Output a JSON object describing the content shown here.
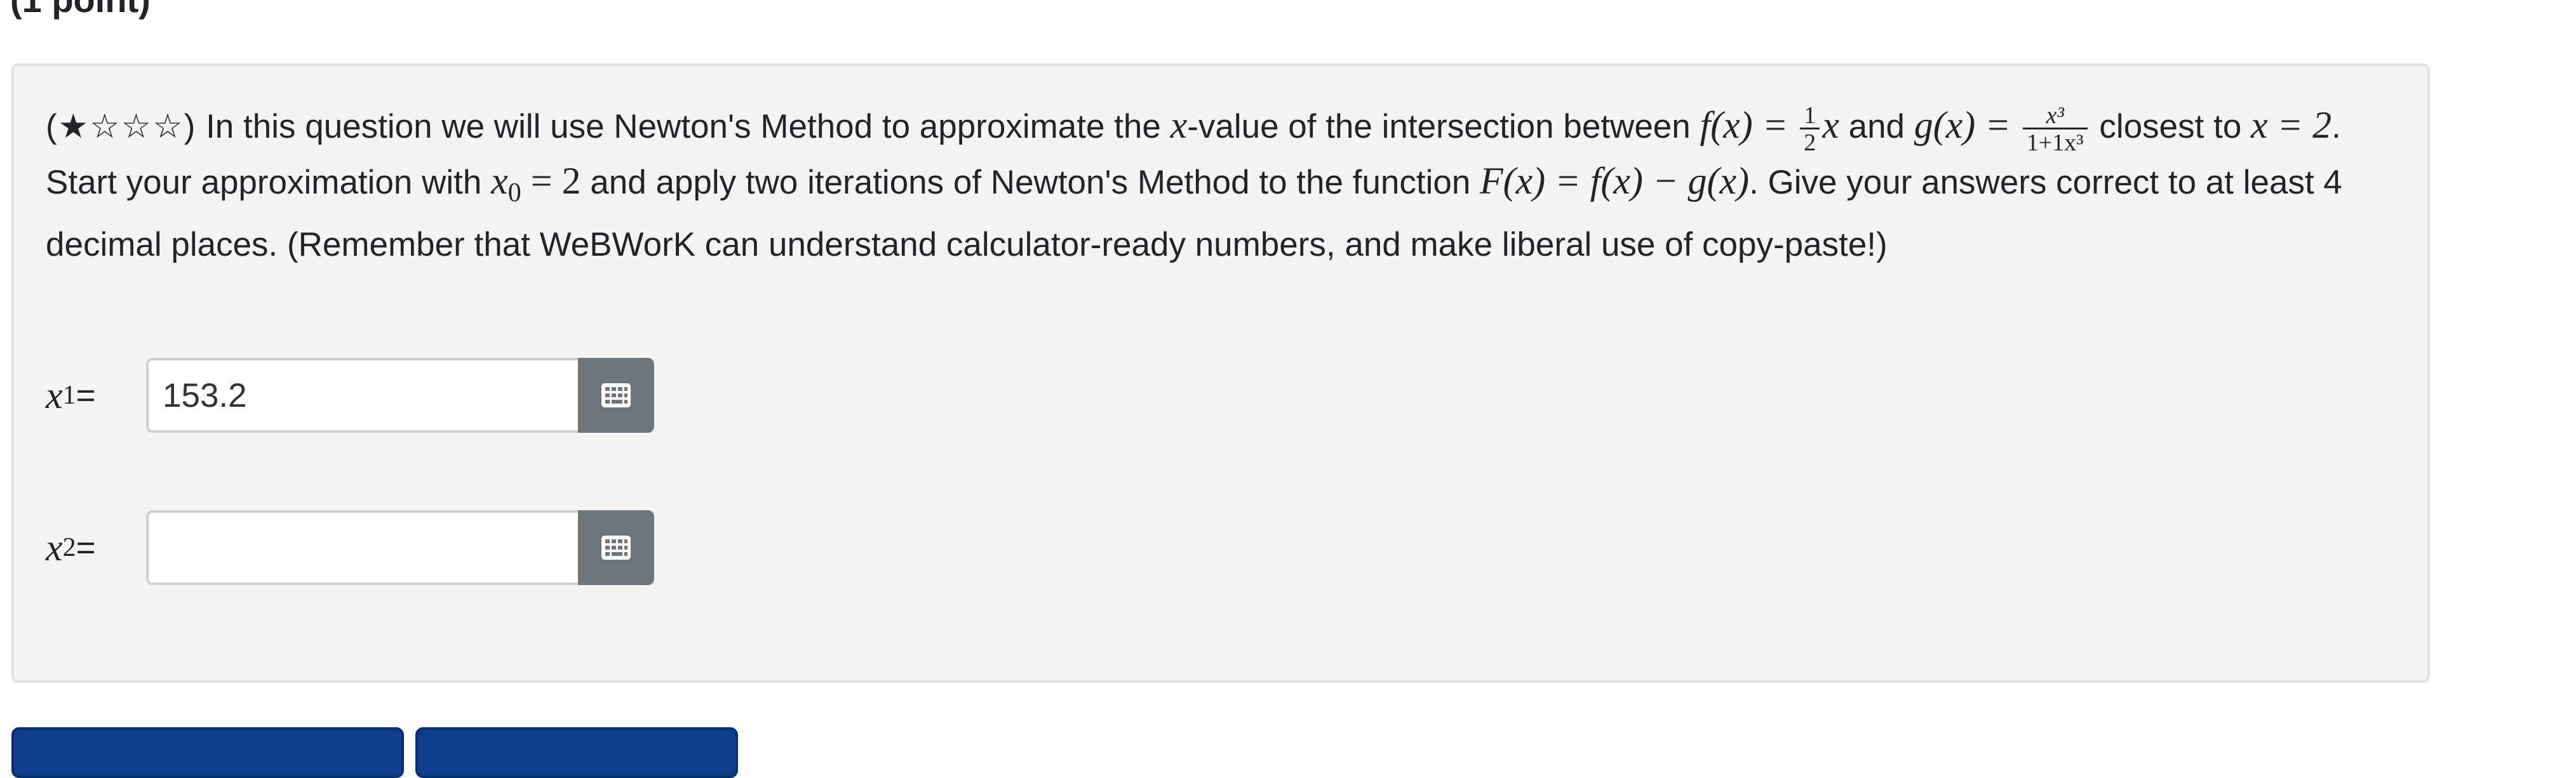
{
  "heading": {
    "points": "(1 point)"
  },
  "problem": {
    "stars": "(★☆☆☆)",
    "intro": " In this question we will use Newton's Method to approximate the ",
    "xvar": "x",
    "value_of": "-value of the intersection between ",
    "f_def": "f(x) = ",
    "half_num": "1",
    "half_den": "2",
    "x_after_half": "x",
    "and": " and ",
    "g_def": "g(x) = ",
    "g_num": "x³",
    "g_den": "1+1x³",
    "closest_to": " closest to ",
    "x_eq_2": "x = 2",
    "start_with": ". Start your approximation with ",
    "x0": "x",
    "x0_sub": "0",
    "eq_2": " = 2",
    "apply": " and apply two iterations of Newton's Method to the function ",
    "F_def": "F(x) = f(x) − g(x)",
    "tail": ". Give your answers correct to at least 4 decimal places. (Remember that WeBWorK can understand calculator-ready numbers, and make liberal use of copy-paste!)"
  },
  "answers": [
    {
      "var": "x",
      "sub": "1",
      "eq": " =",
      "value": "153.2"
    },
    {
      "var": "x",
      "sub": "2",
      "eq": " =",
      "value": ""
    }
  ],
  "icons": {
    "keypad": "calculator-keypad-icon"
  },
  "colors": {
    "box_bg": "#f4f4f4",
    "keypad_bg": "#6c757d",
    "button_bg": "#0b3f8c"
  }
}
